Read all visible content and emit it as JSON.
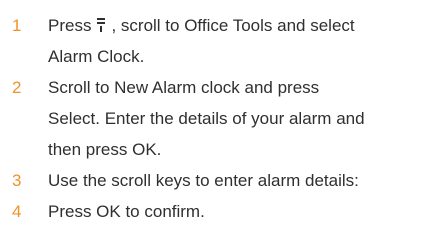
{
  "colors": {
    "number": "#f0922b",
    "text": "#2f2f2f"
  },
  "steps": [
    {
      "number": "1",
      "before_icon": "Press",
      "icon": "menu-key-icon",
      "after_icon": ", scroll to Office Tools and select",
      "line2": "Alarm Clock."
    },
    {
      "number": "2",
      "line1": "Scroll to New Alarm clock and press",
      "line2": "Select. Enter the details of your alarm and",
      "line3": "then press OK."
    },
    {
      "number": "3",
      "line1": "Use the scroll keys to enter alarm details:"
    },
    {
      "number": "4",
      "line1": "Press OK to confirm."
    }
  ]
}
